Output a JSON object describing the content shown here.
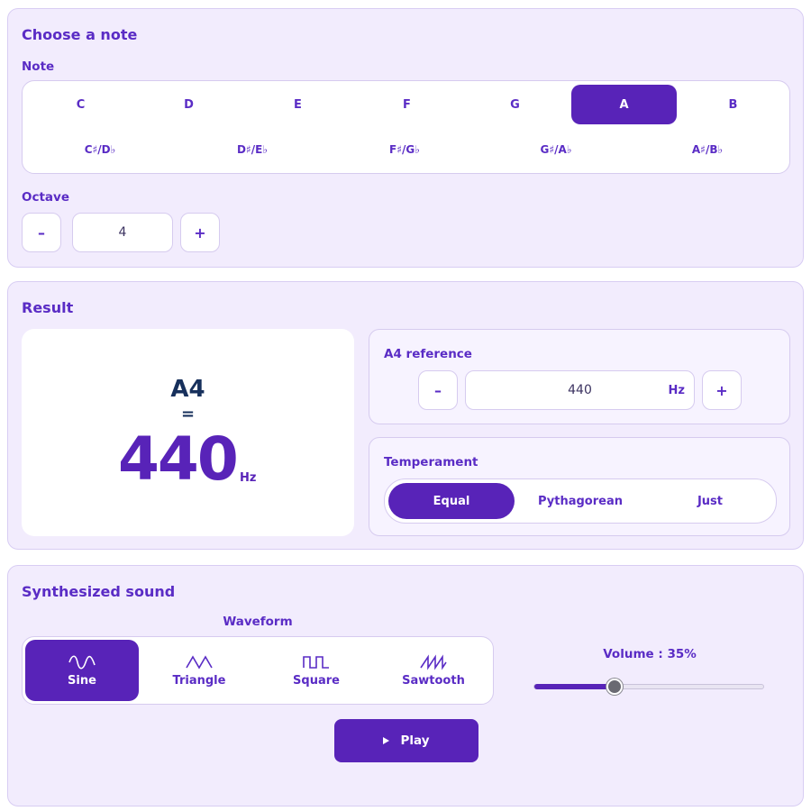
{
  "note_panel": {
    "title": "Choose a note",
    "note_label": "Note",
    "natural_notes": [
      "C",
      "D",
      "E",
      "F",
      "G",
      "A",
      "B"
    ],
    "selected_note": "A",
    "sharp_notes": [
      "C♯/D♭",
      "D♯/E♭",
      "F♯/G♭",
      "G♯/A♭",
      "A♯/B♭"
    ],
    "octave_label": "Octave",
    "octave_value": "4",
    "decrement_label": "–",
    "increment_label": "+"
  },
  "result_panel": {
    "title": "Result",
    "note_name": "A4",
    "equals": "=",
    "frequency": "440",
    "unit": "Hz",
    "reference": {
      "label": "A4 reference",
      "value": "440",
      "unit": "Hz",
      "decrement_label": "–",
      "increment_label": "+"
    },
    "temperament": {
      "label": "Temperament",
      "options": [
        "Equal",
        "Pythagorean",
        "Just"
      ],
      "selected": "Equal"
    }
  },
  "sound_panel": {
    "title": "Synthesized sound",
    "waveform_label": "Waveform",
    "waveforms": [
      {
        "name": "Sine",
        "icon": "sine-wave-icon"
      },
      {
        "name": "Triangle",
        "icon": "triangle-wave-icon"
      },
      {
        "name": "Square",
        "icon": "square-wave-icon"
      },
      {
        "name": "Sawtooth",
        "icon": "sawtooth-wave-icon"
      }
    ],
    "selected_waveform": "Sine",
    "volume_label": "Volume : 35%",
    "volume_percent": 35,
    "play_label": "Play"
  },
  "colors": {
    "accent": "#5823b8",
    "panel_bg": "#f2ecfd",
    "text_dark": "#17305c"
  }
}
